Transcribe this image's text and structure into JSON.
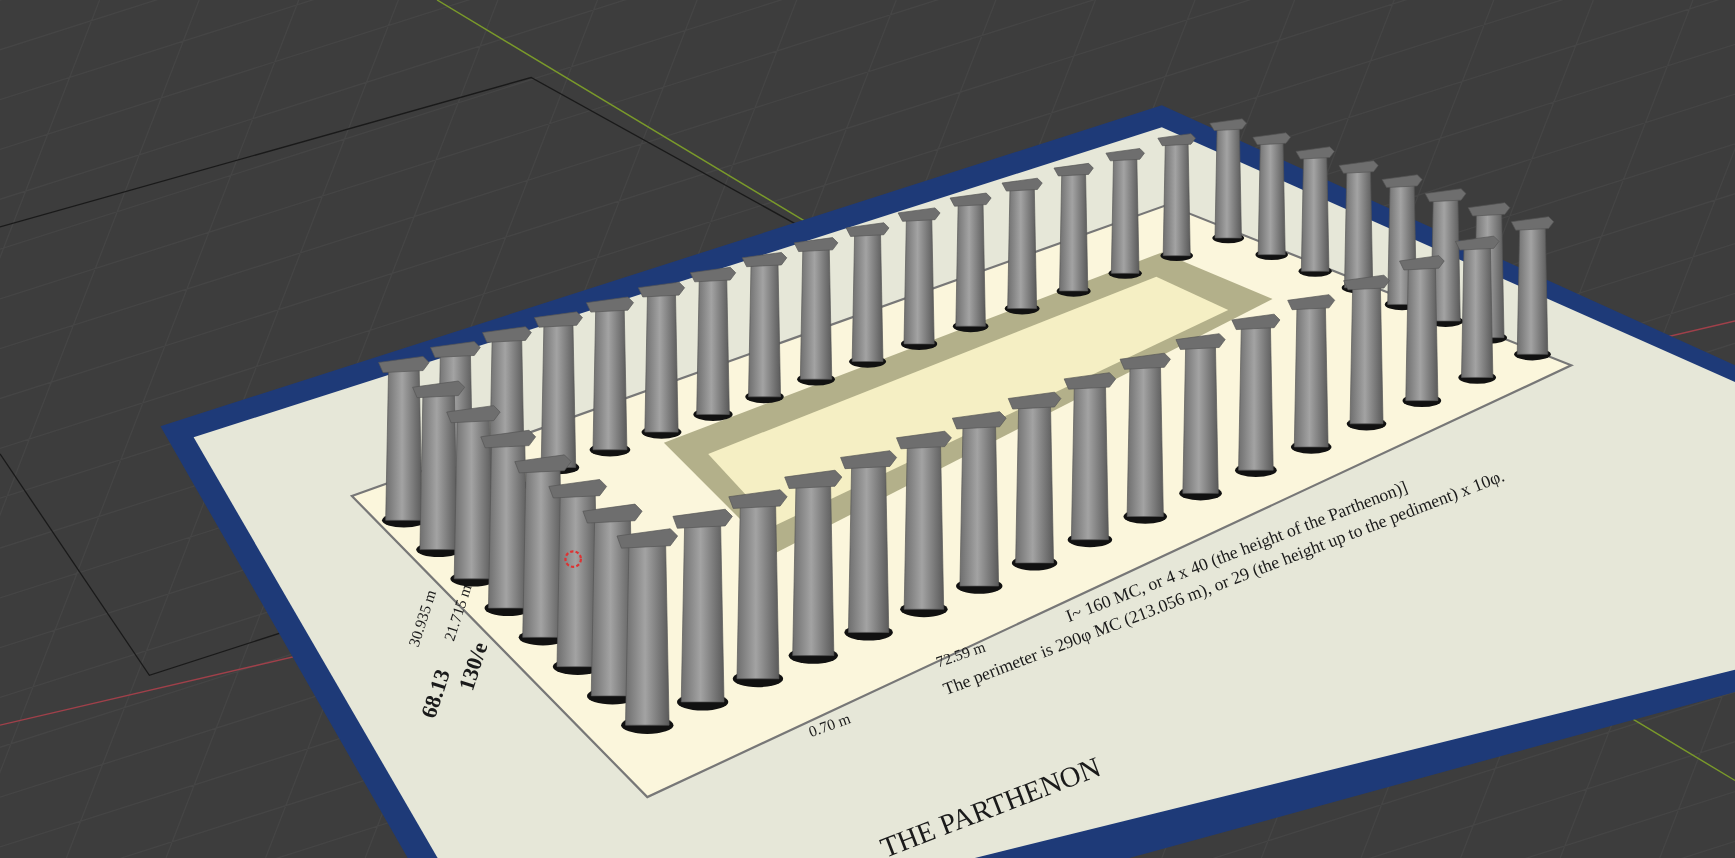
{
  "viewport": {
    "plan_texts": [
      {
        "kind": "title",
        "text": "THE PARTHENON"
      },
      {
        "kind": "dimension",
        "text": "72.59 m"
      },
      {
        "kind": "note",
        "text": "I~ 160 MC, or 4 x 40 (the height of the Parthenon)]"
      },
      {
        "kind": "note",
        "text": "The perimeter is 290φ MC (213.056 m), or 29 (the height up to the pediment) x 10φ."
      },
      {
        "kind": "dimension",
        "text": "0.70 m"
      },
      {
        "kind": "big",
        "text": "68.13"
      },
      {
        "kind": "big",
        "text": "130/e"
      },
      {
        "kind": "dimension",
        "text": "21.715 m"
      },
      {
        "kind": "dimension",
        "text": "30.935 m"
      }
    ]
  }
}
